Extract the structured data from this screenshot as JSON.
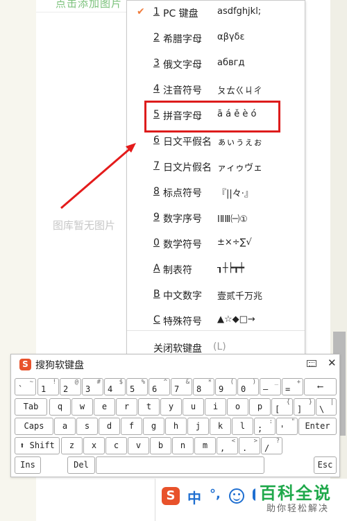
{
  "background": {
    "link_text": "点击添加图片",
    "placeholder_text": "图库暂无图片"
  },
  "menu": {
    "items": [
      {
        "key": "1",
        "label": "PC 键盘",
        "sample": "asdfghjkl;",
        "checked": true
      },
      {
        "key": "2",
        "label": "希腊字母",
        "sample": "αβγδε",
        "checked": false
      },
      {
        "key": "3",
        "label": "俄文字母",
        "sample": "абвгд",
        "checked": false
      },
      {
        "key": "4",
        "label": "注音符号",
        "sample": "ㄆㄊㄍㄐㄔ",
        "checked": false
      },
      {
        "key": "5",
        "label": "拼音字母",
        "sample": "ā á ě è ó",
        "checked": false
      },
      {
        "key": "6",
        "label": "日文平假名",
        "sample": "ぁぃぅぇぉ",
        "checked": false
      },
      {
        "key": "7",
        "label": "日文片假名",
        "sample": "ァィゥヴェ",
        "checked": false
      },
      {
        "key": "8",
        "label": "标点符号",
        "sample": "『||々·』",
        "checked": false
      },
      {
        "key": "9",
        "label": "数字序号",
        "sample": "ⅠⅡⅢ㈠①",
        "checked": false
      },
      {
        "key": "0",
        "label": "数学符号",
        "sample": "±×÷∑√",
        "checked": false
      },
      {
        "key": "A",
        "label": "制表符",
        "sample": "┒┼┝┳┿",
        "checked": false
      },
      {
        "key": "B",
        "label": "中文数字",
        "sample": "壹贰千万兆",
        "checked": false
      },
      {
        "key": "C",
        "label": "特殊符号",
        "sample": "▲☆◆□→",
        "checked": false
      }
    ],
    "close_label": "关闭软键盘",
    "close_shortcut": "(L)",
    "check_glyph": "✔"
  },
  "keyboard": {
    "title": "搜狗软键盘",
    "logo_letter": "S",
    "close_glyph": "✕",
    "rows": [
      [
        {
          "top": "~",
          "bottom": "`"
        },
        {
          "top": "!",
          "bottom": "1"
        },
        {
          "top": "@",
          "bottom": "2"
        },
        {
          "top": "#",
          "bottom": "3"
        },
        {
          "top": "$",
          "bottom": "4"
        },
        {
          "top": "%",
          "bottom": "5"
        },
        {
          "top": "^",
          "bottom": "6"
        },
        {
          "top": "&",
          "bottom": "7"
        },
        {
          "top": "*",
          "bottom": "8"
        },
        {
          "top": "(",
          "bottom": "9"
        },
        {
          "top": ")",
          "bottom": "0"
        },
        {
          "top": "_",
          "bottom": "–"
        },
        {
          "top": "+",
          "bottom": "="
        },
        {
          "center": "⟵"
        }
      ],
      [
        {
          "center": "Tab"
        },
        {
          "center": "q"
        },
        {
          "center": "w"
        },
        {
          "center": "e"
        },
        {
          "center": "r"
        },
        {
          "center": "t"
        },
        {
          "center": "y"
        },
        {
          "center": "u"
        },
        {
          "center": "i"
        },
        {
          "center": "o"
        },
        {
          "center": "p"
        },
        {
          "top": "{",
          "bottom": "["
        },
        {
          "top": "}",
          "bottom": "]"
        },
        {
          "top": "|",
          "bottom": "\\"
        }
      ],
      [
        {
          "center": "Caps"
        },
        {
          "center": "a"
        },
        {
          "center": "s"
        },
        {
          "center": "d"
        },
        {
          "center": "f"
        },
        {
          "center": "g"
        },
        {
          "center": "h"
        },
        {
          "center": "j"
        },
        {
          "center": "k"
        },
        {
          "center": "l"
        },
        {
          "top": ":",
          "bottom": ";"
        },
        {
          "top": "\"",
          "bottom": "'"
        },
        {
          "center": "Enter"
        }
      ],
      [
        {
          "center": "⬆ Shift"
        },
        {
          "center": "z"
        },
        {
          "center": "x"
        },
        {
          "center": "c"
        },
        {
          "center": "v"
        },
        {
          "center": "b"
        },
        {
          "center": "n"
        },
        {
          "center": "m"
        },
        {
          "top": "<",
          "bottom": ","
        },
        {
          "top": ">",
          "bottom": "."
        },
        {
          "top": "?",
          "bottom": "/"
        }
      ],
      [
        {
          "center": "Ins"
        },
        {
          "center": "Del"
        },
        {
          "center": ""
        },
        {
          "center": "Esc"
        }
      ]
    ]
  },
  "ime_bar": {
    "logo_letter": "S",
    "mode": "中",
    "punct": "°,"
  },
  "watermark": {
    "title": "百科全说",
    "subtitle": "助你轻松解决"
  },
  "colors": {
    "highlight": "#dd1c1c",
    "arrow": "#e41b1b",
    "accent": "#e8522b",
    "ime_blue": "#1f6fd1",
    "watermark_green": "#1fa84a"
  }
}
